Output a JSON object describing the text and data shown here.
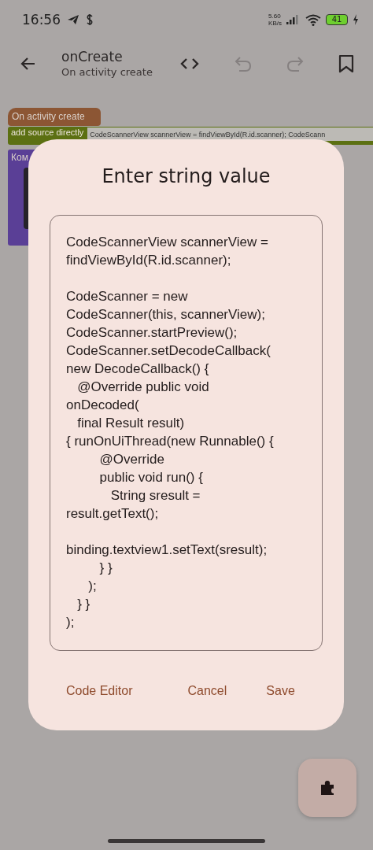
{
  "status_bar": {
    "time": "16:56",
    "speed_value": "5.60",
    "speed_unit": "KB/s",
    "battery": "41"
  },
  "app_bar": {
    "title": "onCreate",
    "subtitle": "On activity create",
    "undo_disabled": true,
    "redo_disabled": true
  },
  "blocks": [
    {
      "kind": "event",
      "label": "On activity create"
    },
    {
      "kind": "statement",
      "label": "add source directly",
      "value": "CodeScannerView scannerView = findViewById(R.id.scanner);  CodeScann"
    },
    {
      "kind": "comment",
      "label": "Ком"
    }
  ],
  "dialog": {
    "title": "Enter string value",
    "value": "CodeScannerView scannerView =\nfindViewById(R.id.scanner);\n\nCodeScanner = new\nCodeScanner(this, scannerView);\nCodeScanner.startPreview();\nCodeScanner.setDecodeCallback(\nnew DecodeCallback() {\n   @Override public void\nonDecoded(\n   final Result result)\n{ runOnUiThread(new Runnable() {\n         @Override\n         public void run() {\n            String sresult =\nresult.getText();\n\nbinding.textview1.setText(sresult);\n         } }\n      );\n   } }\n);",
    "buttons": [
      "Code Editor",
      "Cancel",
      "Save"
    ]
  }
}
